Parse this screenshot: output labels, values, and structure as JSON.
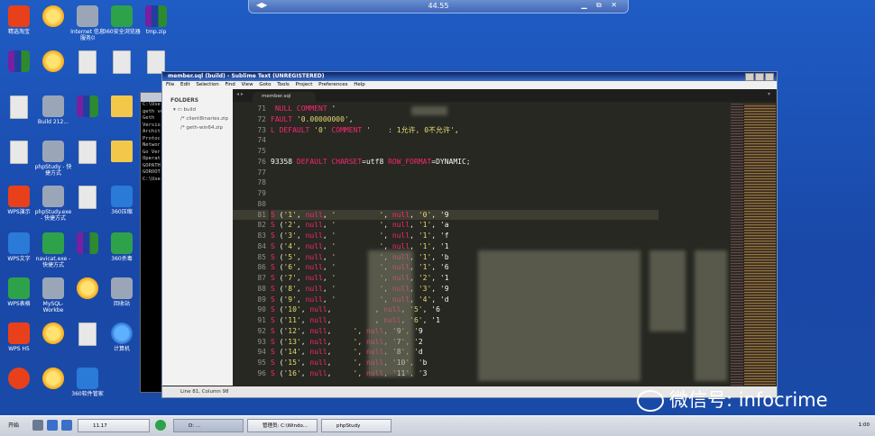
{
  "remote_bar": {
    "title": "44.55",
    "left": "◀▶",
    "right": "▁ ⧉ ✕"
  },
  "desktop_icons": [
    {
      "label": "精选淘宝"
    },
    {
      "label": ""
    },
    {
      "label": "Internet 信息服务(I"
    },
    {
      "label": "360安全浏览器"
    },
    {
      "label": "tmp.zip"
    },
    {
      "label": "Build 212..."
    },
    {
      "label": "phpStudy - 快捷方式"
    },
    {
      "label": "phpStudy.exe - 快捷方式"
    },
    {
      "label": "WPS演示"
    },
    {
      "label": "WPS文字"
    },
    {
      "label": "navicat.exe - 快捷方式"
    },
    {
      "label": "360杀毒"
    },
    {
      "label": "360压缩"
    },
    {
      "label": "WPS表格"
    },
    {
      "label": "MySQL-Workbe"
    },
    {
      "label": "回收站"
    },
    {
      "label": "WPS H5"
    },
    {
      "label": "计算机"
    },
    {
      "label": "360软件管家"
    }
  ],
  "cmd": {
    "lines": [
      "C:\\Use",
      "geth ve",
      "Geth",
      "Versio",
      "Archit",
      "Protoc",
      "Networ",
      "Go Ver",
      "Operat",
      "GOPATH",
      "GOROOT",
      "",
      "C:\\Use"
    ]
  },
  "sublime": {
    "title": "member.sql (build) - Sublime Text (UNREGISTERED)",
    "menu": [
      "File",
      "Edit",
      "Selection",
      "Find",
      "View",
      "Goto",
      "Tools",
      "Project",
      "Preferences",
      "Help"
    ],
    "sidebar": {
      "header": "FOLDERS",
      "folder": "build",
      "files": [
        "client8inaries.zip",
        "geth-win64.zip"
      ]
    },
    "tab": "member.sql",
    "lines": [
      {
        "n": "71",
        "t": " NULL COMMENT '"
      },
      {
        "n": "72",
        "t": "FAULT '0.00000000',"
      },
      {
        "n": "73",
        "t": "L DEFAULT '0' COMMENT '    : 1允许, 0不允许',"
      },
      {
        "n": "74",
        "t": ""
      },
      {
        "n": "75",
        "t": ""
      },
      {
        "n": "76",
        "t": "93358 DEFAULT CHARSET=utf8 ROW_FORMAT=DYNAMIC;"
      },
      {
        "n": "77",
        "t": ""
      },
      {
        "n": "78",
        "t": ""
      },
      {
        "n": "79",
        "t": ""
      },
      {
        "n": "80",
        "t": ""
      },
      {
        "n": "81",
        "t": "S ('1', null, '          ', null, '0', '9"
      },
      {
        "n": "82",
        "t": "S ('2', null, '          ', null, '1', 'a"
      },
      {
        "n": "83",
        "t": "S ('3', null, '          ', null, '1', 'f"
      },
      {
        "n": "84",
        "t": "S ('4', null, '          ', null, '1', '1"
      },
      {
        "n": "85",
        "t": "S ('5', null, '          ', null, '1', 'b"
      },
      {
        "n": "86",
        "t": "S ('6', null, '          ', null, '1', '6"
      },
      {
        "n": "87",
        "t": "S ('7', null, '          ', null, '2', '1"
      },
      {
        "n": "88",
        "t": "S ('8', null, '          ', null, '3', '9"
      },
      {
        "n": "89",
        "t": "S ('9', null, '          ', null, '4', 'd"
      },
      {
        "n": "90",
        "t": "S ('10', null,          , null, '5', '6"
      },
      {
        "n": "91",
        "t": "S ('11', null,          , null, '6', '1"
      },
      {
        "n": "92",
        "t": "S ('12', null,     ', null, '9', '9"
      },
      {
        "n": "93",
        "t": "S ('13', null,     ', null, '7', '2"
      },
      {
        "n": "94",
        "t": "S ('14', null,     ', null, '8', 'd"
      },
      {
        "n": "95",
        "t": "S ('15', null,     ', null, '10', 'b"
      },
      {
        "n": "96",
        "t": "S ('16', null,     ', null, '11', '3"
      }
    ],
    "status": "Line 81, Column 98"
  },
  "watermark": "微信号: infocrime",
  "taskbar": {
    "start": "开始",
    "buttons": [
      "11.17",
      "D: ...",
      "管理员: C:\\Windo...",
      "phpStudy"
    ],
    "tray_time": "1:00"
  }
}
